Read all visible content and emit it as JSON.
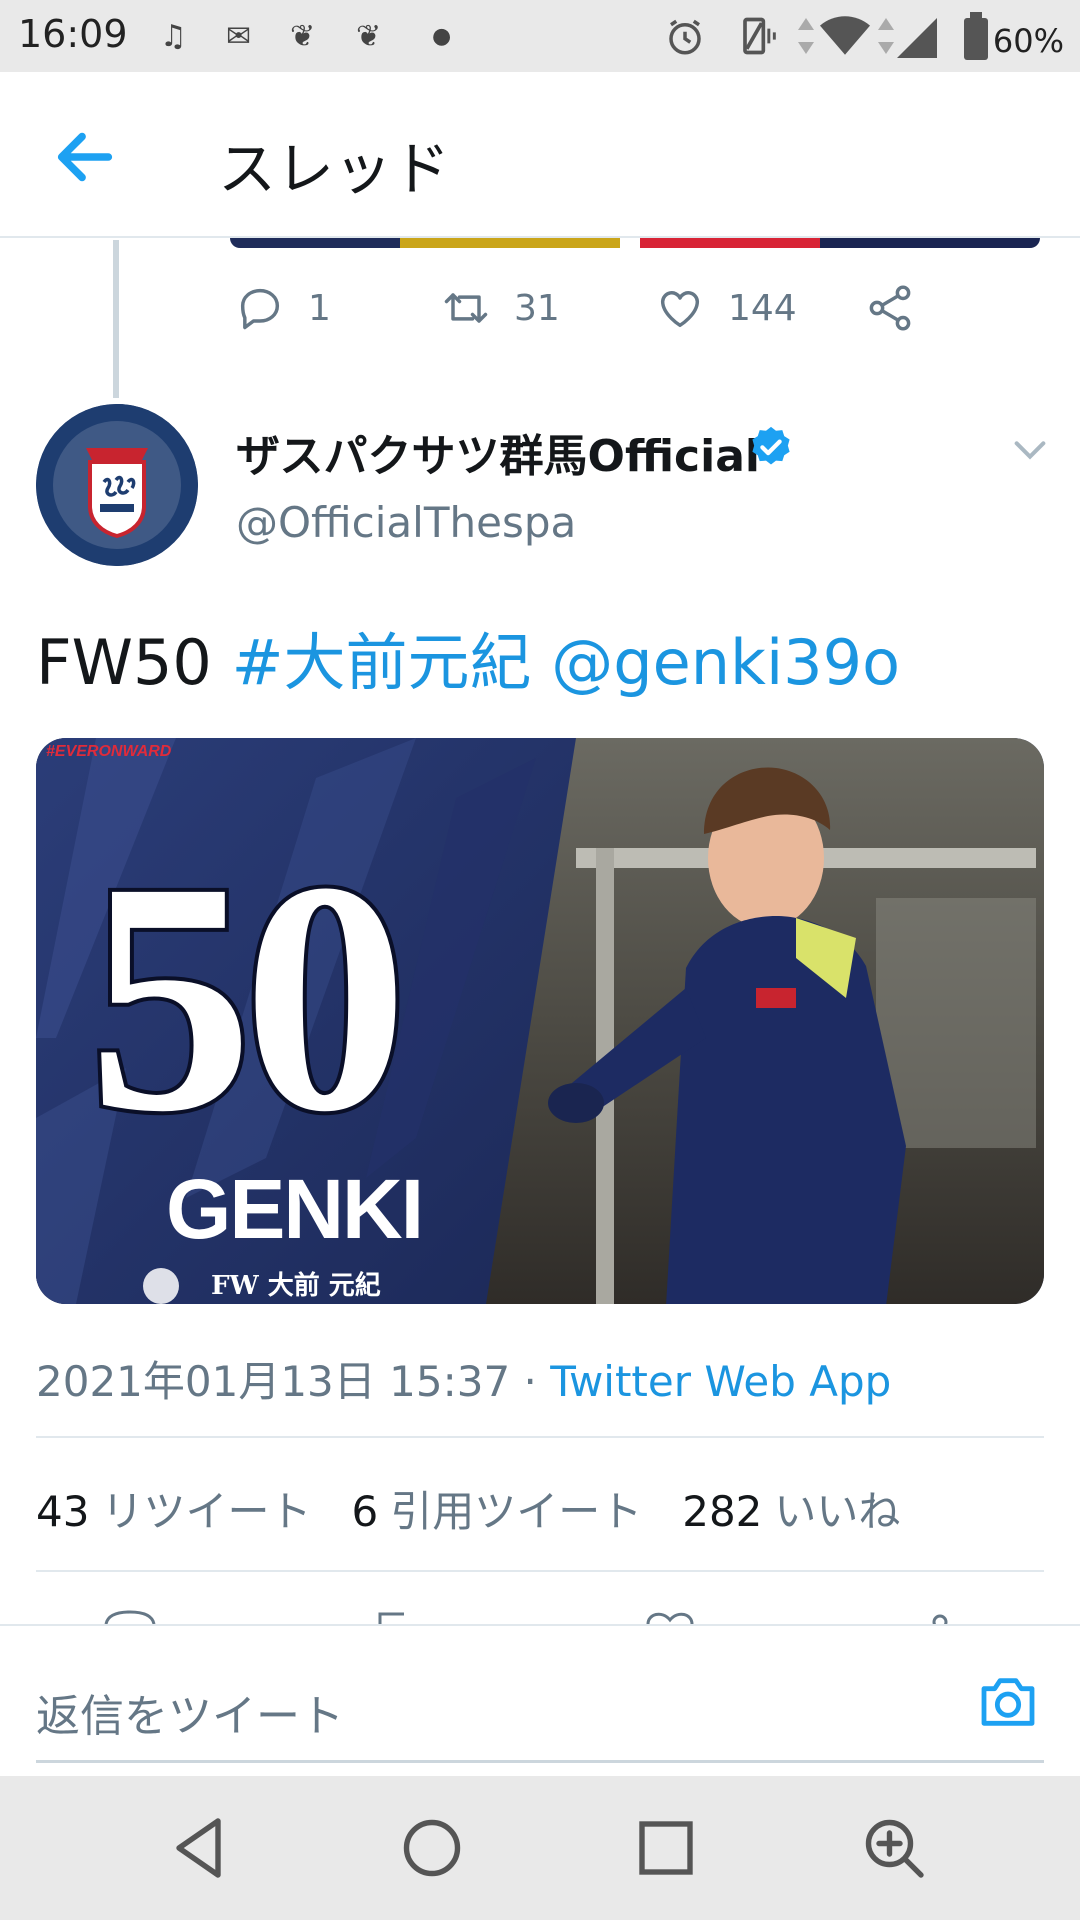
{
  "status_bar": {
    "time": "16:09",
    "battery": "60%",
    "icons": [
      "music-note-icon",
      "mail-icon",
      "app-icon",
      "app-icon",
      "dot-icon",
      "alarm-icon",
      "vibrate-icon",
      "data-arrows-icon",
      "wifi-icon",
      "signal-icon",
      "battery-icon"
    ]
  },
  "header": {
    "title": "スレッド",
    "back_icon": "arrow-left-icon"
  },
  "previous_tweet": {
    "reply_count": "1",
    "retweet_count": "31",
    "like_count": "144"
  },
  "tweet": {
    "display_name": "ザスパクサツ群馬Official",
    "handle": "@OfficialThespa",
    "text_prefix": "FW50 ",
    "hashtag": "#大前元紀",
    "mention": "@genki39o",
    "media": {
      "tag": "#EVERONWARD",
      "number": "50",
      "name": "GENKI",
      "subtitle": "FW 大前 元紀"
    },
    "timestamp": "2021年01月13日 15:37",
    "separator": " · ",
    "via": "Twitter Web App",
    "stats": {
      "retweets": "43",
      "retweets_label": "リツイート",
      "quotes": "6",
      "quotes_label": "引用ツイート",
      "likes": "282",
      "likes_label": "いいね"
    }
  },
  "reply_bar": {
    "placeholder": "返信をツイート"
  },
  "colors": {
    "accent": "#1da1f2",
    "link": "#1b95e0",
    "secondary_text": "#657786"
  }
}
